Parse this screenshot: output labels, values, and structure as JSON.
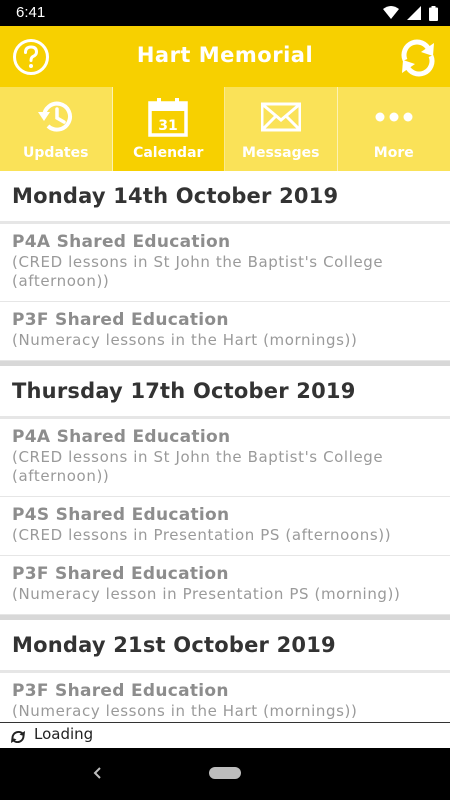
{
  "status_bar": {
    "time": "6:41"
  },
  "app_bar": {
    "title": "Hart Memorial"
  },
  "tabs": [
    {
      "label": "Updates",
      "icon": "updates-history-icon",
      "active": false
    },
    {
      "label": "Calendar",
      "icon": "calendar-icon",
      "day": "31",
      "active": true
    },
    {
      "label": "Messages",
      "icon": "envelope-icon",
      "active": false
    },
    {
      "label": "More",
      "icon": "more-dots-icon",
      "active": false
    }
  ],
  "days": [
    {
      "header": "Monday 14th October 2019",
      "events": [
        {
          "title": "P4A Shared Education",
          "desc": "(CRED lessons in St John the Baptist's College (afternoon))"
        },
        {
          "title": "P3F Shared Education",
          "desc": "(Numeracy lessons in the Hart (mornings))"
        }
      ]
    },
    {
      "header": "Thursday 17th October 2019",
      "events": [
        {
          "title": "P4A Shared Education",
          "desc": "(CRED lessons in St John the Baptist's College (afternoon))"
        },
        {
          "title": "P4S Shared Education",
          "desc": "(CRED lessons in Presentation PS (afternoons))"
        },
        {
          "title": "P3F Shared Education",
          "desc": "(Numeracy lesson in Presentation PS (morning))"
        }
      ]
    },
    {
      "header": "Monday 21st October 2019",
      "events": [
        {
          "title": "P3F Shared Education",
          "desc": "(Numeracy lessons in the Hart (mornings))"
        }
      ]
    }
  ],
  "loading": {
    "label": "Loading"
  },
  "colors": {
    "accent": "#f7d000",
    "tab_inactive": "#fae258"
  }
}
